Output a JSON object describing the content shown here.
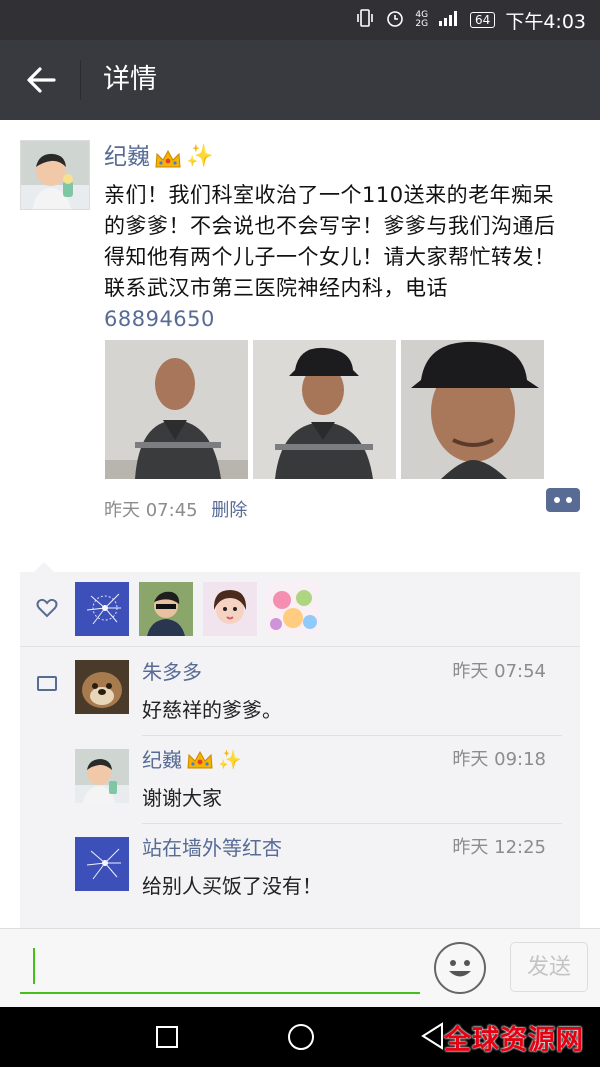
{
  "status_bar": {
    "battery": "64",
    "network": "4G",
    "network_sub": "2G",
    "time": "下午4:03",
    "icons": [
      "vibrate-icon",
      "alarm-icon",
      "signal-icon",
      "battery-icon"
    ]
  },
  "header": {
    "title": "详情",
    "back_icon": "back-arrow-icon"
  },
  "post": {
    "author": "纪巍",
    "author_emoji": [
      "crown-icon",
      "sparkles-icon"
    ],
    "text": "亲们！我们科室收治了一个110送来的老年痴呆的爹爹！不会说也不会写字！爹爹与我们沟通后得知他有两个儿子一个女儿！请大家帮忙转发！联系武汉市第三医院神经内科，电话",
    "phone": "68894650",
    "time": "昨天 07:45",
    "delete_label": "删除",
    "photos": [
      "photo-1",
      "photo-2",
      "photo-3"
    ]
  },
  "likes": {
    "icon": "heart-icon",
    "avatars": [
      "dandelion-avatar",
      "boy-avatar",
      "girl-avatar",
      "candy-avatar"
    ]
  },
  "comments": [
    {
      "name": "朱多多",
      "time": "昨天 07:54",
      "text": "好慈祥的爹爹。"
    },
    {
      "name": "纪巍",
      "time": "昨天 09:18",
      "text": "谢谢大家"
    },
    {
      "name": "站在墙外等红杏",
      "time": "昨天 12:25",
      "text": "给别人买饭了没有！"
    }
  ],
  "input": {
    "send_label": "发送",
    "emoji_icon": "smiley-icon"
  },
  "watermark": "全球资源网",
  "colors": {
    "link": "#576b95",
    "header_bg": "#393a3f",
    "accent_green": "#45c01a"
  }
}
